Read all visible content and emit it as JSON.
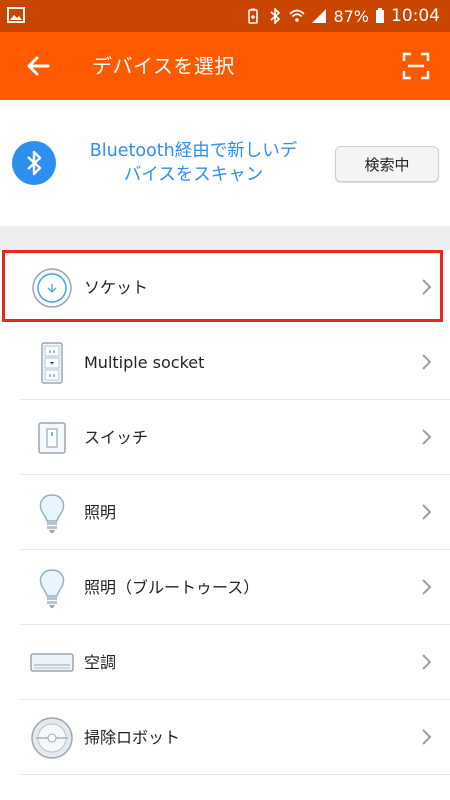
{
  "status_bar": {
    "battery": "87%",
    "time": "10:04",
    "icons": [
      "image-icon",
      "battery-saver-icon",
      "bluetooth-icon",
      "wifi-icon",
      "signal-icon",
      "battery-icon"
    ]
  },
  "app_bar": {
    "title": "デバイスを選択",
    "back_icon": "arrow-left-icon",
    "scan_icon": "qr-scan-icon",
    "color": "#ff5a00"
  },
  "bluetooth": {
    "text_line1": "Bluetooth経由で新しいデ",
    "text_line2": "バイスをスキャン",
    "button_label": "検索中",
    "accent": "#2d8ff0"
  },
  "devices": [
    {
      "label": "ソケット",
      "icon": "socket-icon",
      "selected": true
    },
    {
      "label": "Multiple socket",
      "icon": "multiple-socket-icon"
    },
    {
      "label": "スイッチ",
      "icon": "switch-icon"
    },
    {
      "label": "照明",
      "icon": "bulb-icon"
    },
    {
      "label": "照明（ブルートゥース）",
      "icon": "bulb-icon"
    },
    {
      "label": "空調",
      "icon": "air-conditioner-icon"
    },
    {
      "label": "掃除ロボット",
      "icon": "robot-vacuum-icon"
    }
  ],
  "highlight_color": "#e8281f"
}
